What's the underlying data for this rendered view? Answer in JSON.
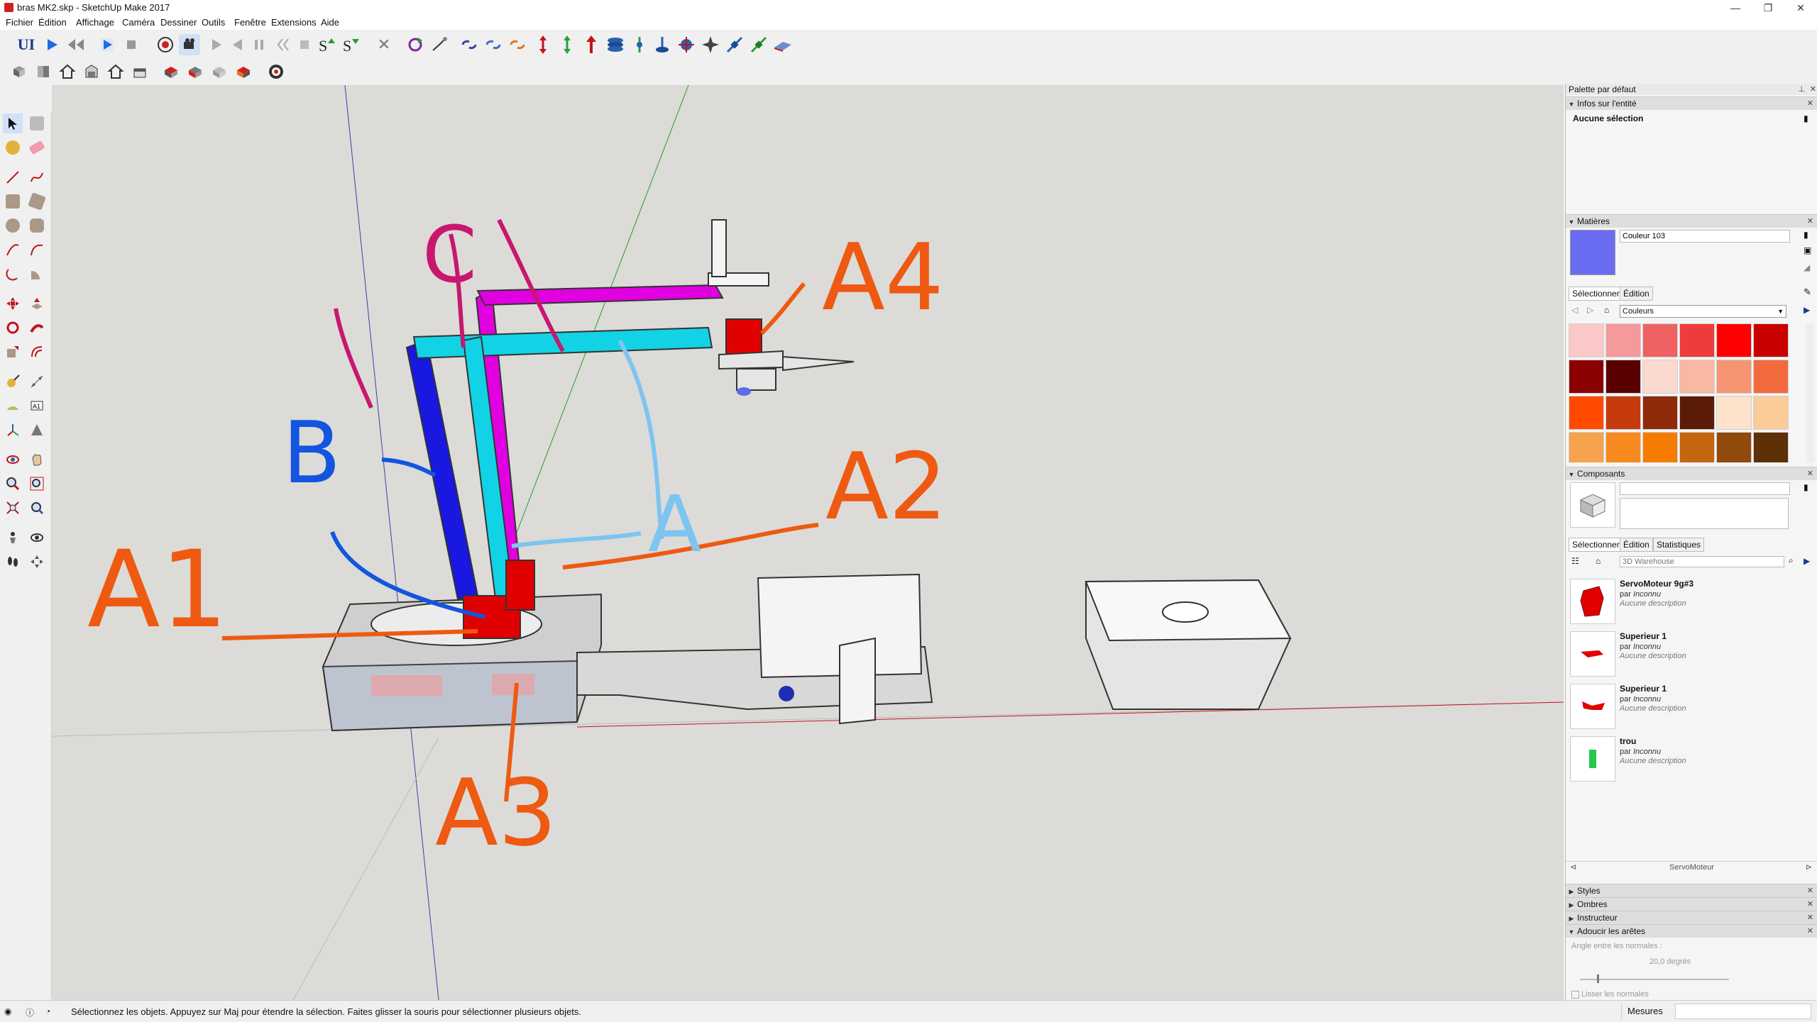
{
  "window": {
    "title": "bras MK2.skp - SketchUp Make 2017",
    "controls": {
      "minimize": "—",
      "maximize": "❐",
      "close": "✕"
    }
  },
  "menubar": [
    "Fichier",
    "Édition",
    "Affichage",
    "Caméra",
    "Dessiner",
    "Outils",
    "Fenêtre",
    "Extensions",
    "Aide"
  ],
  "toolbar": {
    "ui_label": "UI"
  },
  "annotations": {
    "A1": "A1",
    "A2": "A2",
    "A3": "A3",
    "A4": "A4",
    "A": "A",
    "B": "B",
    "C": "C"
  },
  "right_panel": {
    "tray_title": "Palette par défaut",
    "entity_info": {
      "title": "Infos sur l'entité",
      "selection": "Aucune sélection"
    },
    "materials": {
      "title": "Matières",
      "current_name": "Couleur 103",
      "current_color": "#6a6cf2",
      "tab_select": "Sélectionner",
      "tab_edit": "Édition",
      "library": "Couleurs",
      "swatches": [
        "#fbc7c7",
        "#f59a9a",
        "#f06262",
        "#ef3b3b",
        "#ff0000",
        "#c80000",
        "#8b0000",
        "#5a0000",
        "#fbd9cf",
        "#f9b8a3",
        "#f79572",
        "#f26a3d",
        "#ff4a00",
        "#c73a0d",
        "#8f2a0a",
        "#5a1c07",
        "#fde3cb",
        "#fbcb99",
        "#f7a24c",
        "#f68a1f",
        "#f57c00",
        "#c66510",
        "#8f4a0c",
        "#5e3008"
      ]
    },
    "components": {
      "title": "Composants",
      "tab_select": "Sélectionner",
      "tab_edit": "Édition",
      "tab_stats": "Statistiques",
      "search_placeholder": "3D Warehouse",
      "items": [
        {
          "name": "ServoMoteur 9g#3",
          "by_label": "par",
          "author": "Inconnu",
          "desc": "Aucune description"
        },
        {
          "name": "Superieur 1",
          "by_label": "par",
          "author": "Inconnu",
          "desc": "Aucune description"
        },
        {
          "name": "Superieur 1",
          "by_label": "par",
          "author": "Inconnu",
          "desc": "Aucune description"
        },
        {
          "name": "trou",
          "by_label": "par",
          "author": "Inconnu",
          "desc": "Aucune description"
        }
      ],
      "footer": "ServoMoteur"
    },
    "styles": "Styles",
    "shadows": "Ombres",
    "instructor": "Instructeur",
    "soften": {
      "title": "Adoucir les arêtes",
      "angle_label": "Angle entre les normales :",
      "angle_value": "20,0  degrés",
      "smooth_normals": "Lisser les normales"
    }
  },
  "statusbar": {
    "message": "Sélectionnez les objets. Appuyez sur Maj pour étendre la sélection. Faites glisser la souris pour sélectionner plusieurs objets.",
    "measures_label": "Mesures"
  }
}
